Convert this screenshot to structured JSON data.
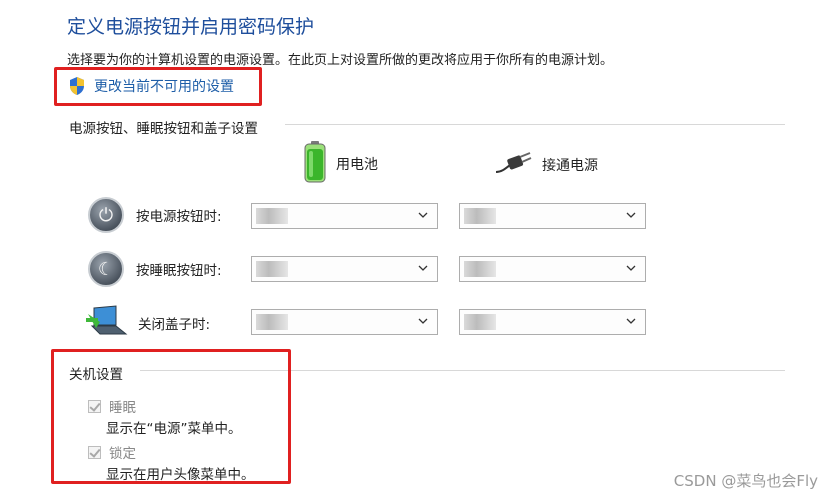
{
  "page": {
    "title": "定义电源按钮并启用密码保护",
    "description": "选择要为你的计算机设置的电源设置。在此页上对设置所做的更改将应用于你所有的电源计划。",
    "change_link": "更改当前不可用的设置"
  },
  "power_section": {
    "title": "电源按钮、睡眠按钮和盖子设置",
    "columns": [
      {
        "label": "用电池",
        "icon": "battery-icon"
      },
      {
        "label": "接通电源",
        "icon": "plug-icon"
      }
    ],
    "rows": [
      {
        "label": "按电源按钮时:",
        "icon": "power-button-icon",
        "battery_value": "",
        "plugged_value": ""
      },
      {
        "label": "按睡眠按钮时:",
        "icon": "sleep-button-icon",
        "battery_value": "",
        "plugged_value": ""
      },
      {
        "label": "关闭盖子时:",
        "icon": "laptop-lid-icon",
        "battery_value": "",
        "plugged_value": ""
      }
    ]
  },
  "shutdown_section": {
    "title": "关机设置",
    "options": [
      {
        "label": "睡眠",
        "description": "显示在“电源”菜单中。",
        "checked": true,
        "enabled": false
      },
      {
        "label": "锁定",
        "description": "显示在用户头像菜单中。",
        "checked": true,
        "enabled": false
      }
    ]
  },
  "watermark": "CSDN @菜鸟也会Fly",
  "colors": {
    "title": "#1e4e9c",
    "link": "#1e5ea8",
    "highlight_box": "#e02020"
  }
}
